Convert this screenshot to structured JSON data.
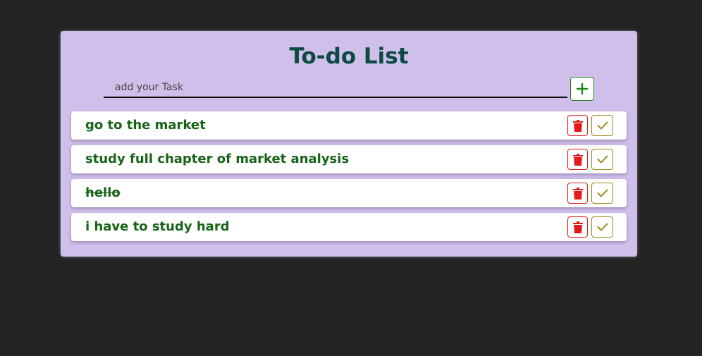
{
  "app": {
    "title": "To-do List"
  },
  "input": {
    "placeholder": "add your Task",
    "value": ""
  },
  "tasks": [
    {
      "text": "go to the market",
      "completed": false
    },
    {
      "text": "study full chapter of market analysis",
      "completed": false
    },
    {
      "text": "hello",
      "completed": true
    },
    {
      "text": "i have to study hard",
      "completed": false
    }
  ],
  "icons": {
    "add": "plus-icon",
    "delete": "trash-icon",
    "complete": "check-icon"
  },
  "colors": {
    "page_background": "#232323",
    "card_background": "#cfbfea",
    "title": "#0d4a44",
    "task_text": "#176317",
    "add_accent": "#1a8a1a",
    "delete_accent": "#e21a1a",
    "check_accent": "#9c8a1a"
  }
}
